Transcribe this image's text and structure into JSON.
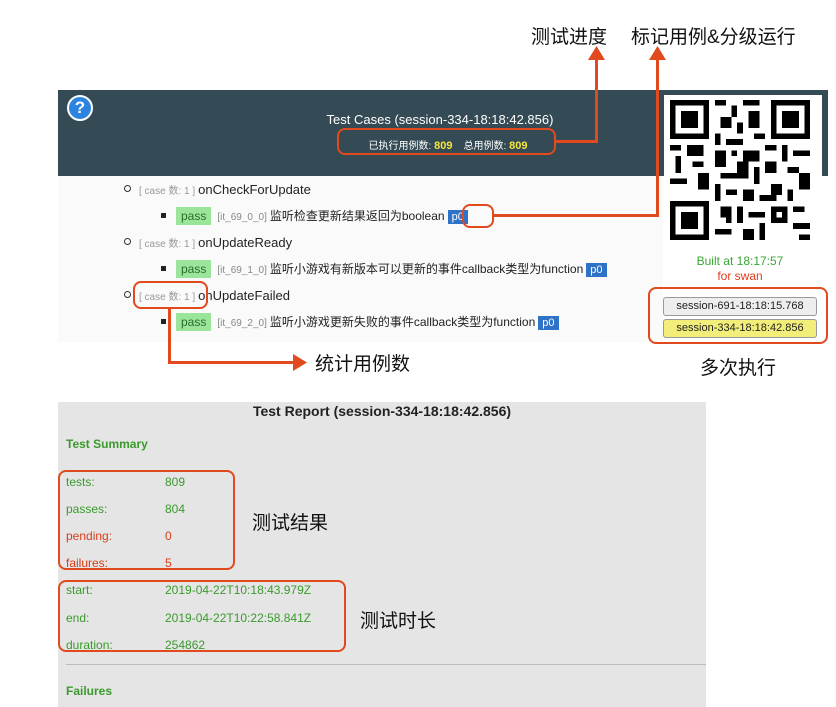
{
  "header": {
    "help_icon": "?",
    "title": "Test Cases (session-334-18:18:42.856)",
    "executed_label": "已执行用例数:",
    "executed_count": "809",
    "total_label": "总用例数:",
    "total_count": "809"
  },
  "cases": [
    {
      "count": "[ case 数: 1 ]",
      "name": "onCheckForUpdate",
      "test": {
        "status": "pass",
        "id": "[it_69_0_0]",
        "desc": "监听检查更新结果返回为boolean",
        "priority": "p0"
      }
    },
    {
      "count": "[ case 数: 1 ]",
      "name": "onUpdateReady",
      "test": {
        "status": "pass",
        "id": "[it_69_1_0]",
        "desc": "监听小游戏有新版本可以更新的事件callback类型为function",
        "priority": "p0"
      }
    },
    {
      "count": "[ case 数: 1 ]",
      "name": "onUpdateFailed",
      "test": {
        "status": "pass",
        "id": "[it_69_2_0]",
        "desc": "监听小游戏更新失败的事件callback类型为function",
        "priority": "p0"
      }
    }
  ],
  "sidebar": {
    "built": "Built at 18:17:57",
    "for": "for swan",
    "sessions": [
      {
        "label": "session-691-18:18:15.768",
        "active": false
      },
      {
        "label": "session-334-18:18:42.856",
        "active": true
      }
    ]
  },
  "report": {
    "title": "Test Report (session-334-18:18:42.856)",
    "summary_heading": "Test Summary",
    "stats": [
      {
        "label": "tests:",
        "value": "809"
      },
      {
        "label": "passes:",
        "value": "804"
      },
      {
        "label": "pending:",
        "value": "0"
      },
      {
        "label": "failures:",
        "value": "5"
      },
      {
        "label": "start:",
        "value": "2019-04-22T10:18:43.979Z"
      },
      {
        "label": "end:",
        "value": "2019-04-22T10:22:58.841Z"
      },
      {
        "label": "duration:",
        "value": "254862"
      }
    ],
    "failures_heading": "Failures"
  },
  "annotations": {
    "progress": "测试进度",
    "mark_cases": "标记用例&分级运行",
    "count_cases": "统计用例数",
    "multi_run": "多次执行",
    "results": "测试结果",
    "duration": "测试时长"
  },
  "colors": {
    "header_bg": "#344a55",
    "annotation": "#e04a1e",
    "pass_bg": "#9be59b",
    "priority_bg": "#2f73c8",
    "highlight_num": "#f4e63c",
    "active_session": "#f3ee79",
    "report_green": "#3a9a2c",
    "report_red": "#d83c18"
  }
}
